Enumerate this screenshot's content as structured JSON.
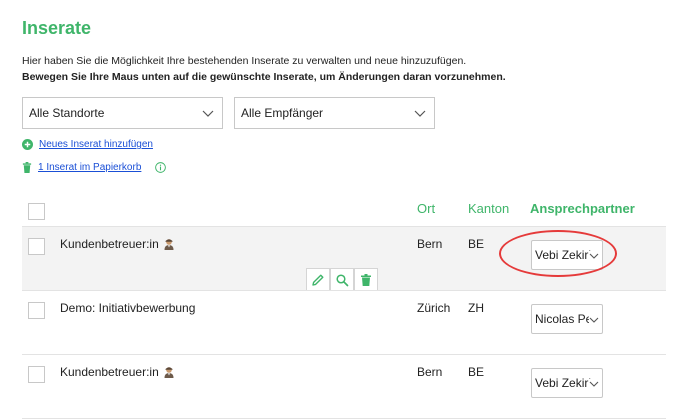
{
  "page": {
    "title": "Inserate",
    "intro_line1": "Hier haben Sie die Möglichkeit Ihre bestehenden Inserate zu verwalten und neue hinzuzufügen.",
    "intro_line2": "Bewegen Sie Ihre Maus unten auf die gewünschte Inserate, um Änderungen daran vorzunehmen."
  },
  "filters": {
    "location": "Alle Standorte",
    "recipient": "Alle Empfänger"
  },
  "actions": {
    "new_ad": "Neues Inserat hinzufügen",
    "trash": "1 Inserat im Papierkorb"
  },
  "table": {
    "headers": {
      "ort": "Ort",
      "kanton": "Kanton",
      "contact": "Ansprechpartner"
    },
    "rows": [
      {
        "title": "Kundenbetreuer:in",
        "ort": "Bern",
        "kanton": "BE",
        "contact": "Vebi Zekiri"
      },
      {
        "title": "Demo: Initiativbewerbung",
        "ort": "Zürich",
        "kanton": "ZH",
        "contact": "Nicolas Pe"
      },
      {
        "title": "Kundenbetreuer:in",
        "ort": "Bern",
        "kanton": "BE",
        "contact": "Vebi Zekiri"
      }
    ]
  },
  "icons": [
    "chevron-down-icon",
    "plus-circle-icon",
    "trash-icon",
    "info-icon",
    "person-emoji-icon",
    "edit-icon",
    "search-icon"
  ],
  "colors": {
    "accent": "#3fb56a",
    "link": "#1a4fd6",
    "highlight": "#e53a3a"
  }
}
